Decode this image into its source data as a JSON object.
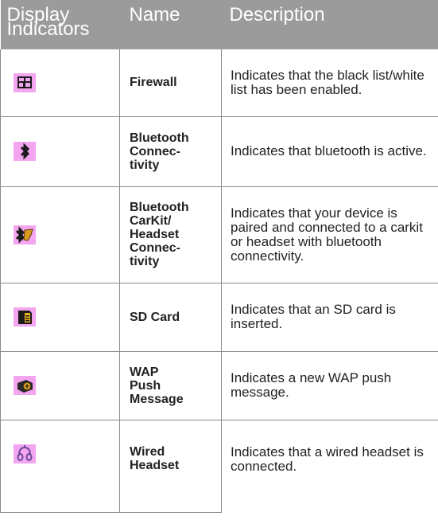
{
  "header": {
    "col_icon_line1": "Display",
    "col_icon_line2": "Indicators",
    "col_name": "Name",
    "col_desc": "Description"
  },
  "rows": [
    {
      "icon": "firewall-icon",
      "name_lines": [
        "Firewall"
      ],
      "description": "Indicates that the black list/white list has been enabled."
    },
    {
      "icon": "bluetooth-icon",
      "name_lines": [
        "Bluetooth",
        "Connec-",
        "tivity"
      ],
      "description": "Indicates that bluetooth is active."
    },
    {
      "icon": "bluetooth-carkit-icon",
      "name_lines": [
        "Bluetooth",
        "CarKit/",
        "Headset",
        "Connec-",
        "tivity"
      ],
      "description": "Indicates that your device is paired and connected to a carkit or headset with bluetooth connectivity."
    },
    {
      "icon": "sd-card-icon",
      "name_lines": [
        "SD Card"
      ],
      "description": "Indicates that an SD card is inserted."
    },
    {
      "icon": "wap-push-message-icon",
      "name_lines": [
        "WAP",
        "Push",
        "Message"
      ],
      "description": "Indicates a new WAP push message."
    },
    {
      "icon": "wired-headset-icon",
      "name_lines": [
        "Wired",
        "Headset"
      ],
      "description": "Indicates that a wired headset is connected."
    }
  ],
  "colors": {
    "header_bg": "#9b9b9b",
    "icon_bg": "#f4a5f0",
    "rule": "#8a8a8a"
  }
}
